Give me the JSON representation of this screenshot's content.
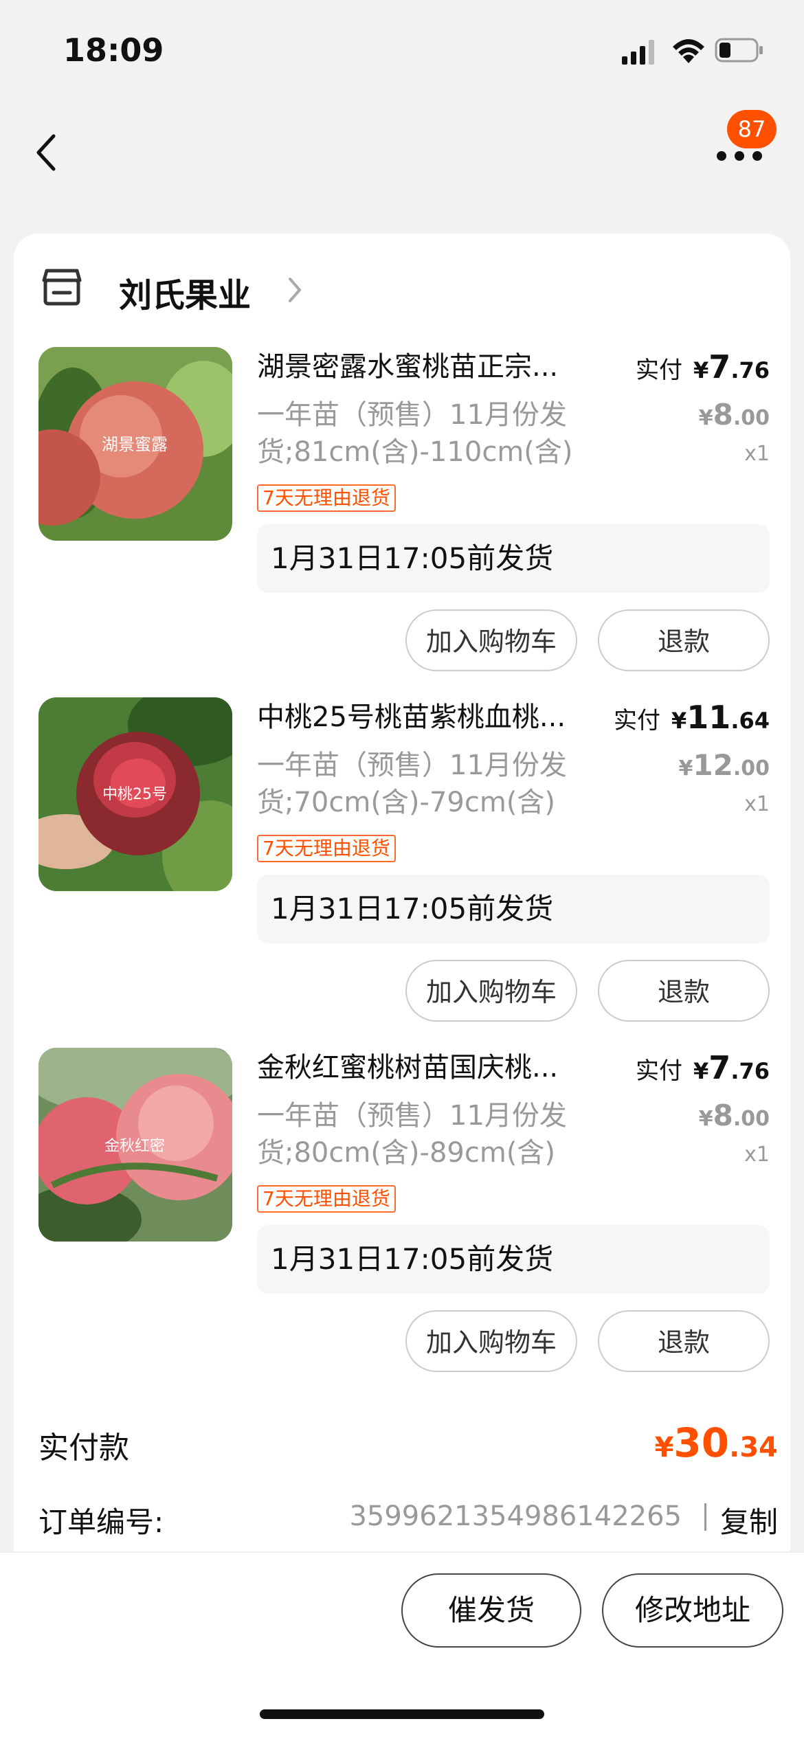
{
  "status_bar": {
    "time": "18:09"
  },
  "nav": {
    "badge_count": "87"
  },
  "shop": {
    "name": "刘氏果业"
  },
  "items": [
    {
      "title": "湖景密露水蜜桃苗正宗...",
      "spec": "一年苗（预售）11月份发货;81cm(含)-110cm(含)",
      "tag": "7天无理由退货",
      "paid_label": "实付",
      "paid_currency": "¥",
      "paid_int": "7",
      "paid_dec": ".76",
      "orig_currency": "¥",
      "orig_int": "8",
      "orig_dec": ".00",
      "qty": "x1",
      "ship": "1月31日17:05前发货",
      "cart_btn": "加入购物车",
      "refund_btn": "退款",
      "image_text": "湖景蜜露"
    },
    {
      "title": "中桃25号桃苗紫桃血桃...",
      "spec": "一年苗（预售）11月份发货;70cm(含)-79cm(含)",
      "tag": "7天无理由退货",
      "paid_label": "实付",
      "paid_currency": "¥",
      "paid_int": "11",
      "paid_dec": ".64",
      "orig_currency": "¥",
      "orig_int": "12",
      "orig_dec": ".00",
      "qty": "x1",
      "ship": "1月31日17:05前发货",
      "cart_btn": "加入购物车",
      "refund_btn": "退款",
      "image_text": "中桃25号"
    },
    {
      "title": "金秋红蜜桃树苗国庆桃...",
      "spec": "一年苗（预售）11月份发货;80cm(含)-89cm(含)",
      "tag": "7天无理由退货",
      "paid_label": "实付",
      "paid_currency": "¥",
      "paid_int": "7",
      "paid_dec": ".76",
      "orig_currency": "¥",
      "orig_int": "8",
      "orig_dec": ".00",
      "qty": "x1",
      "ship": "1月31日17:05前发货",
      "cart_btn": "加入购物车",
      "refund_btn": "退款",
      "image_text": "金秋红密"
    }
  ],
  "summary": {
    "total_label": "实付款",
    "total_currency": "¥",
    "total_int": "30",
    "total_dec": ".34",
    "order_label": "订单编号:",
    "order_number": "3599621354986142265",
    "copy": "复制"
  },
  "bottom_bar": {
    "urge_button": "催发货",
    "address_button": "修改地址"
  },
  "colors": {
    "accent": "#ff5000",
    "muted": "#999999"
  },
  "icons": [
    "back-icon",
    "more-icon",
    "shop-icon",
    "chevron-right-icon",
    "signal-icon",
    "wifi-icon",
    "battery-icon"
  ]
}
